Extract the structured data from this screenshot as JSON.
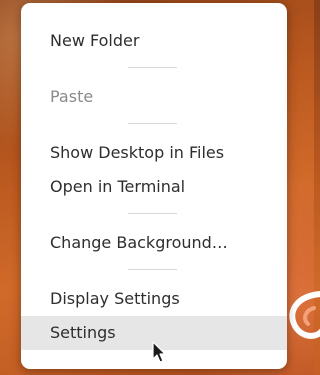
{
  "menu": {
    "items": [
      {
        "label": "New Folder",
        "enabled": true
      },
      {
        "label": "Paste",
        "enabled": false
      },
      {
        "label": "Show Desktop in Files",
        "enabled": true
      },
      {
        "label": "Open in Terminal",
        "enabled": true
      },
      {
        "label": "Change Background…",
        "enabled": true
      },
      {
        "label": "Display Settings",
        "enabled": true
      },
      {
        "label": "Settings",
        "enabled": true,
        "hovered": true
      }
    ]
  },
  "colors": {
    "menu_background": "#ffffff",
    "text": "#2e2e2e",
    "disabled_text": "#8a8a8a",
    "hover_background": "#e6e6e6",
    "wallpaper": "#b9581f"
  },
  "icons": {
    "pointer": "mouse-pointer-icon"
  }
}
